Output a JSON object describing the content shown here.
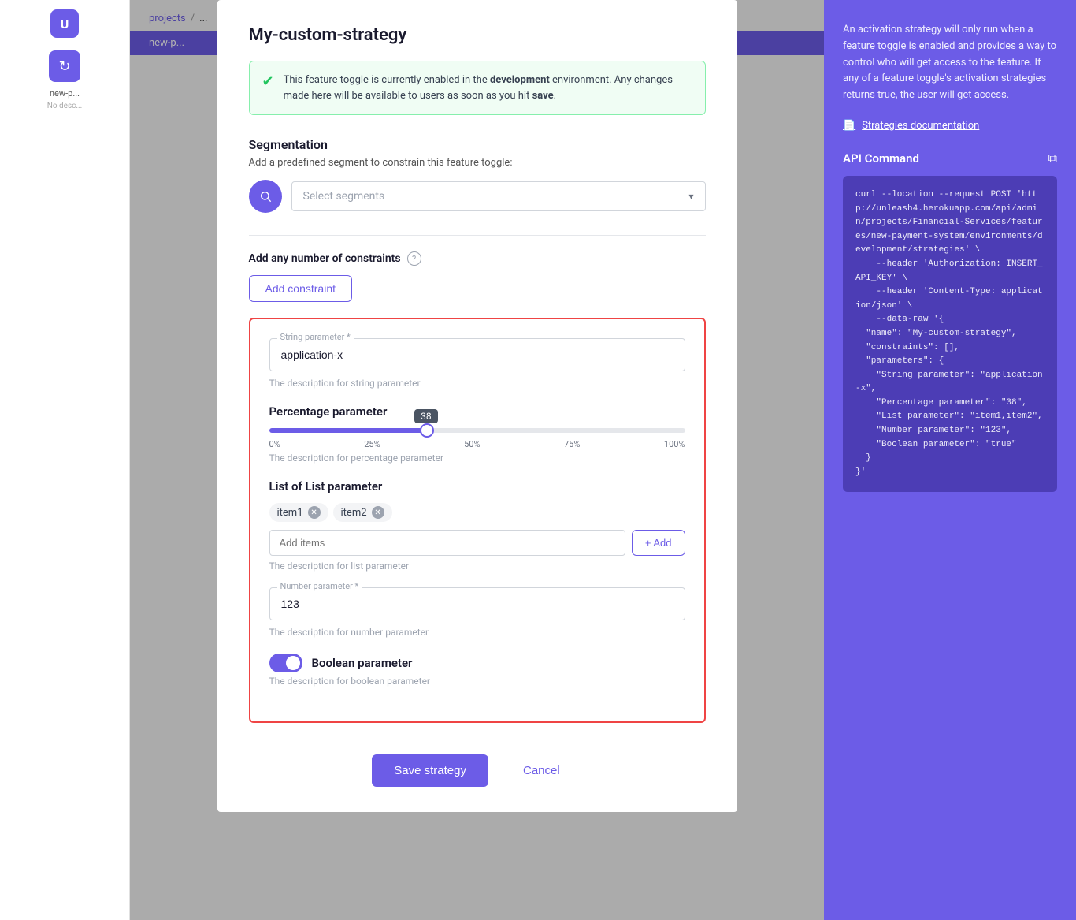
{
  "app": {
    "logo": "U",
    "sidebar_icon": "↻"
  },
  "breadcrumb": {
    "projects_label": "projects",
    "separator": "/",
    "current": "..."
  },
  "toggle_name": "new-p...",
  "modal": {
    "title": "My-custom-strategy",
    "banner": {
      "text_before_bold": "This feature toggle is currently enabled in the ",
      "bold_text": "development",
      "text_after": " environment. Any changes made here will be available to users as soon as you hit ",
      "bold_save": "save",
      "text_end": "."
    },
    "segmentation": {
      "title": "Segmentation",
      "description": "Add a predefined segment to constrain this feature toggle:",
      "placeholder": "Select segments"
    },
    "constraints": {
      "title": "Add any number of constraints",
      "add_btn": "Add constraint"
    },
    "params": {
      "string_label": "String parameter *",
      "string_value": "application-x",
      "string_desc": "The description for string parameter",
      "percentage_title": "Percentage parameter",
      "percentage_value": 38,
      "percentage_desc": "The description for percentage parameter",
      "slider_marks": [
        "0%",
        "25%",
        "50%",
        "75%",
        "100%"
      ],
      "list_title": "List of List parameter",
      "list_tags": [
        "item1",
        "item2"
      ],
      "list_placeholder": "Add items",
      "list_add_btn": "+ Add",
      "list_desc": "The description for list parameter",
      "number_label": "Number parameter *",
      "number_value": "123",
      "number_desc": "The description for number parameter",
      "boolean_label": "Boolean parameter",
      "boolean_desc": "The description for boolean parameter"
    },
    "footer": {
      "save_btn": "Save strategy",
      "cancel_btn": "Cancel"
    }
  },
  "right_panel": {
    "description": "An activation strategy will only run when a feature toggle is enabled and provides a way to control who will get access to the feature. If any of a feature toggle's activation strategies returns true, the user will get access.",
    "doc_link": "Strategies documentation",
    "api_title": "API Command",
    "api_code": "curl --location --request POST 'http://unleash4.herokuapp.com/api/admin/projects/Financial-Services/features/new-payment-system/environments/development/strategies' \\\n    --header 'Authorization: INSERT_API_KEY' \\\n    --header 'Content-Type: application/json' \\\n    --data-raw '{\n  \"name\": \"My-custom-strategy\",\n  \"constraints\": [],\n  \"parameters\": {\n    \"String parameter\": \"application-x\",\n    \"Percentage parameter\": \"38\",\n    \"List parameter\": \"item1,item2\",\n    \"Number parameter\": \"123\",\n    \"Boolean parameter\": \"true\"\n  }\n}'"
  }
}
